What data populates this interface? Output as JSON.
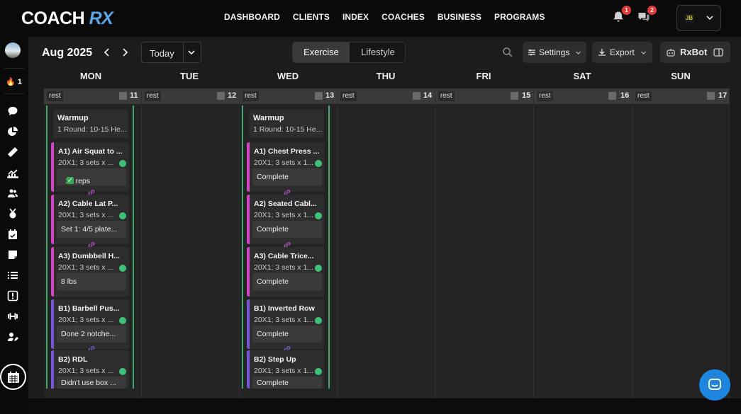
{
  "brand": {
    "logo_main": "COACH",
    "logo_accent": "RX"
  },
  "nav": [
    "DASHBOARD",
    "CLIENTS",
    "INDEX",
    "COACHES",
    "BUSINESS",
    "PROGRAMS"
  ],
  "notifications": {
    "bell_count": "1",
    "chat_count": "2"
  },
  "account": {
    "mini_logo": "JB"
  },
  "sidebar": {
    "streak": "1"
  },
  "toolbar": {
    "month": "Aug 2025",
    "today": "Today",
    "tabs": [
      "Exercise",
      "Lifestyle"
    ],
    "settings": "Settings",
    "export": "Export",
    "rxbot": "RxBot"
  },
  "days": [
    {
      "name": "MON",
      "date": "11",
      "tag": "rest"
    },
    {
      "name": "TUE",
      "date": "12",
      "tag": "rest"
    },
    {
      "name": "WED",
      "date": "13",
      "tag": "rest"
    },
    {
      "name": "THU",
      "date": "14",
      "tag": "rest"
    },
    {
      "name": "FRI",
      "date": "15",
      "tag": "rest"
    },
    {
      "name": "SAT",
      "date": "16",
      "tag": "rest"
    },
    {
      "name": "SUN",
      "date": "17",
      "tag": "rest"
    }
  ],
  "workouts": {
    "mon": {
      "warmup": {
        "title": "Warmup",
        "detail": "1 Round: 10-15 He..."
      },
      "exercises": [
        {
          "title": "A1) Air Squat to ...",
          "detail": "20X1; 3 sets x ...",
          "result": "10 reps"
        },
        {
          "title": "A2) Cable Lat P...",
          "detail": "20X1; 3 sets x ...",
          "result": "Set 1: 4/5 plate..."
        },
        {
          "title": "A3) Dumbbell H...",
          "detail": "20X1; 3 sets x ...",
          "result": "8 lbs"
        },
        {
          "title": "B1) Barbell Pus...",
          "detail": "20X1; 3 sets x ...",
          "result": "Done 2 notche..."
        },
        {
          "title": "B2) RDL",
          "detail": "20X1; 3 sets x ...",
          "result": "Didn't use box ..."
        }
      ]
    },
    "wed": {
      "warmup": {
        "title": "Warmup",
        "detail": "1 Round: 10-15 He..."
      },
      "exercises": [
        {
          "title": "A1) Chest Press ...",
          "detail": "20X1; 3 sets x 1...",
          "result": "Complete"
        },
        {
          "title": "A2) Seated Cabl...",
          "detail": "20X1; 3 sets x 1...",
          "result": "Complete"
        },
        {
          "title": "A3) Cable Trice...",
          "detail": "20X1; 3 sets x 1...",
          "result": "Complete"
        },
        {
          "title": "B1) Inverted Row",
          "detail": "20X1; 3 sets x 1...",
          "result": "Complete"
        },
        {
          "title": "B2) Step Up",
          "detail": "20X1; 3 sets x 1...",
          "result": "Complete"
        }
      ]
    }
  },
  "colors": {
    "superset_a": "#d444c8",
    "superset_b": "#7757d8",
    "complete": "#3ec27a",
    "chat_button": "#1f86e0"
  }
}
